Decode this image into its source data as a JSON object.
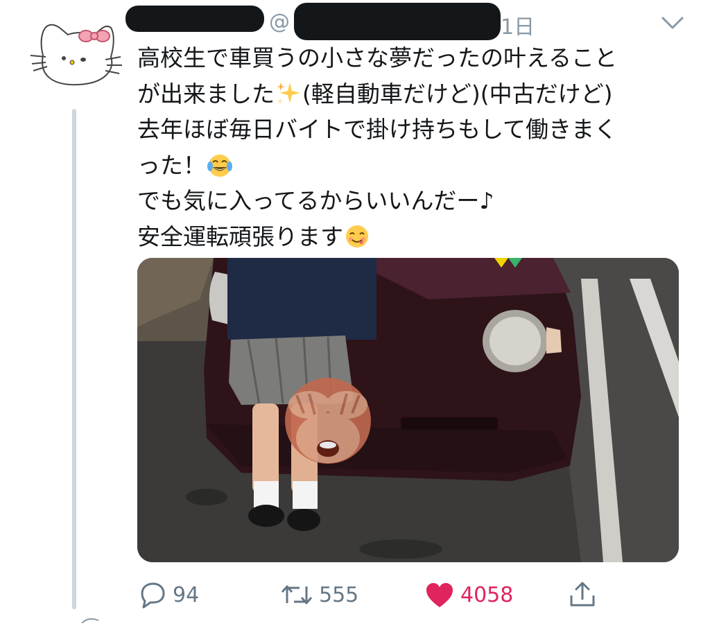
{
  "tweet": {
    "handle_prefix": "@",
    "time": "1日",
    "lines": [
      "高校生で車買うの小さな夢だったの叶えること",
      "が出来ました",
      "(軽自動車だけど)(中古だけど)",
      "去年ほぼ毎日バイトで掛け持ちもして働きまく",
      "った！",
      "でも気に入ってるからいいんだー♪",
      "安全運転頑張ります"
    ],
    "emojis": [
      "sparkles",
      "joy",
      "yum"
    ]
  },
  "actions": {
    "reply_count": "94",
    "retweet_count": "555",
    "like_count": "4058"
  },
  "colors": {
    "like": "#e0245e",
    "muted": "#657786",
    "thread_line": "#ccd6dd"
  },
  "icons": [
    "hello-kitty-avatar-icon",
    "chevron-down-icon",
    "reply-icon",
    "retweet-icon",
    "heart-icon",
    "share-icon",
    "sparkles-emoji",
    "joy-emoji",
    "yum-emoji",
    "see-no-evil-monkey-emoji"
  ]
}
